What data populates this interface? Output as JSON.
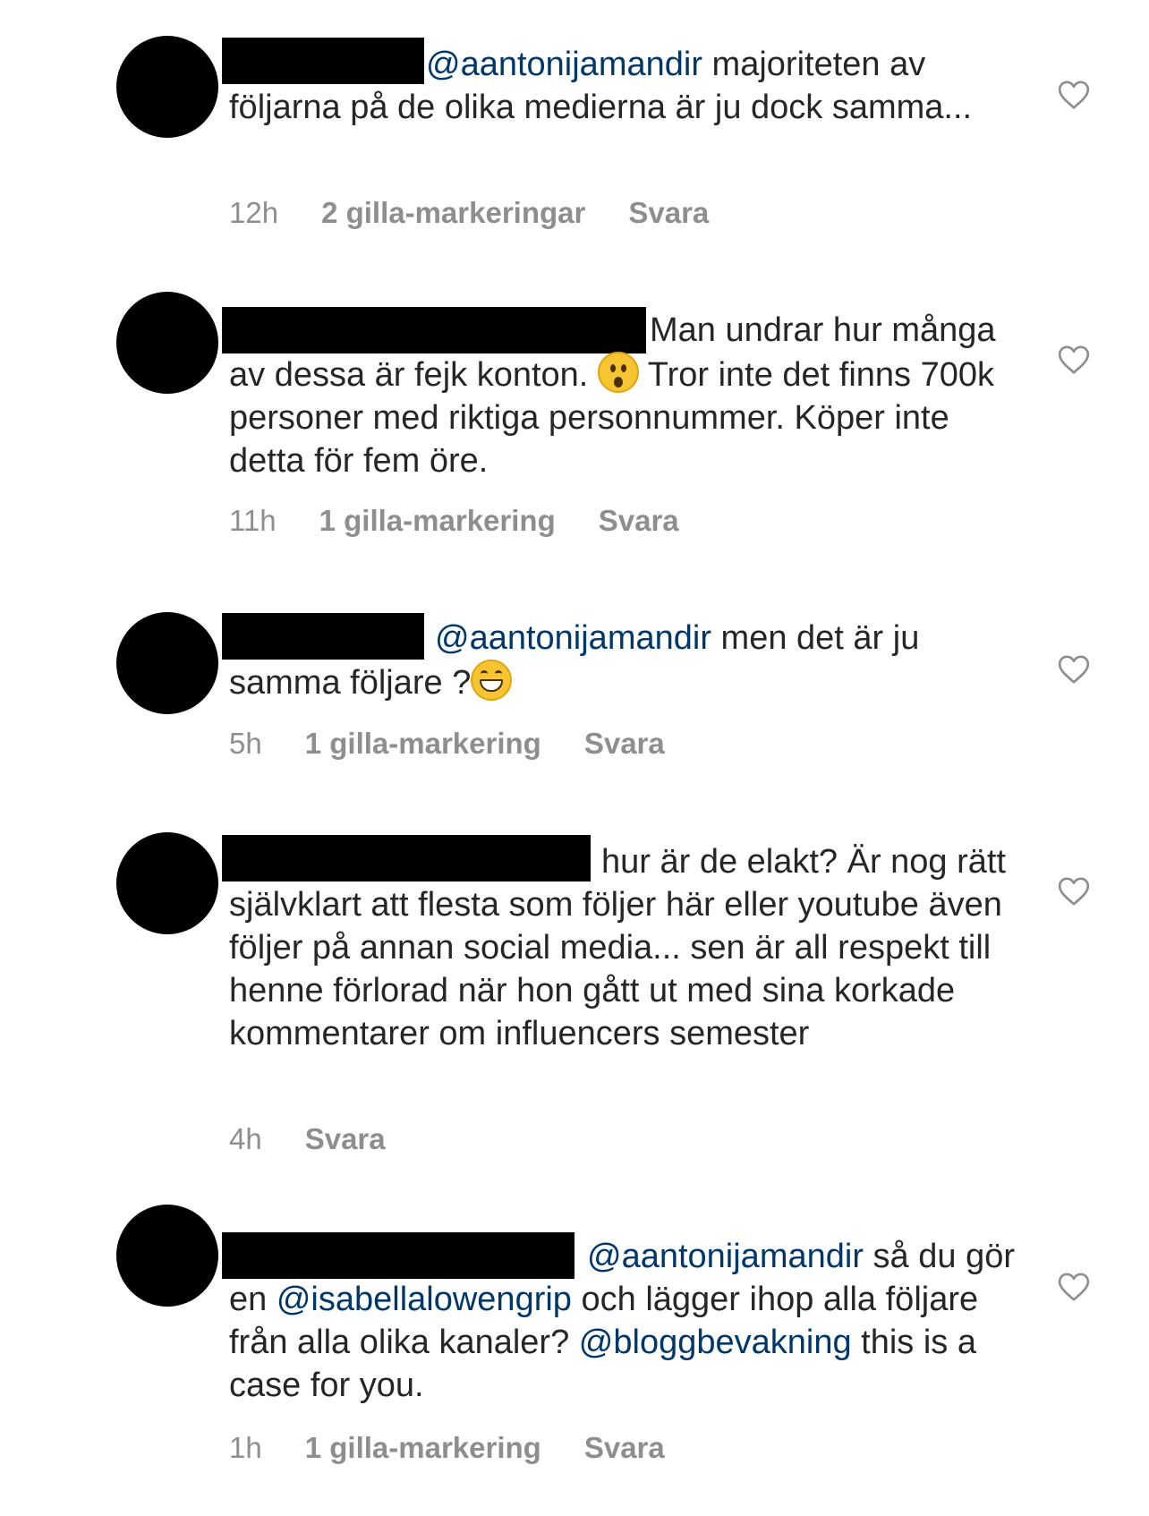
{
  "comments": [
    {
      "text_line1": "majoriteten av",
      "mention": "@aantonijamandir",
      "text_rest": "följarna på de olika medierna är ju dock samma...",
      "time": "12h",
      "likes": "2 gilla-markeringar",
      "reply": "Svara"
    },
    {
      "text_a": "Man undrar hur",
      "text_b": "många av dessa är fejk konton.",
      "emoji": "surprised-face-icon",
      "text_c": "Tror inte det finns 700k personer med riktiga personnummer. Köper inte detta för fem öre.",
      "time": "11h",
      "likes": "1 gilla-markering",
      "reply": "Svara"
    },
    {
      "mention": "@aantonijamandir",
      "text_a": "men det är ju",
      "text_b": "samma följare ?",
      "emoji": "grinning-face-icon",
      "time": "5h",
      "likes": "1 gilla-markering",
      "reply": "Svara"
    },
    {
      "text_a": "hur är de elakt? Är nog",
      "text_b": "rätt självklart att flesta som följer här eller youtube även följer på annan social media... sen är all respekt till henne förlorad när hon gått ut med sina korkade kommentarer om influencers semester",
      "time": "4h",
      "reply": "Svara"
    },
    {
      "mention1": "@aantonijamandir",
      "text_a": "så",
      "text_b": "du gör en",
      "mention2": "@isabellalowengrip",
      "text_c": "och lägger ihop alla följare från alla olika kanaler?",
      "mention3": "@bloggbevakning",
      "text_d": "this is a case for you.",
      "time": "1h",
      "likes": "1 gilla-markering",
      "reply": "Svara"
    }
  ],
  "colors": {
    "text": "#262626",
    "mention": "#00376b",
    "meta": "#8e8e8e",
    "redaction": "#000000"
  }
}
